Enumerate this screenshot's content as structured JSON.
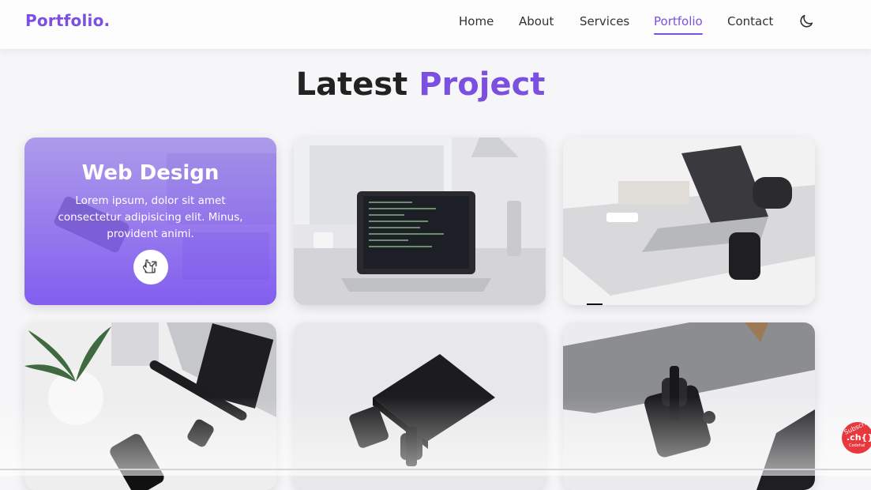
{
  "header": {
    "logo": "Portfolio.",
    "nav": [
      {
        "label": "Home"
      },
      {
        "label": "About"
      },
      {
        "label": "Services"
      },
      {
        "label": "Portfolio",
        "active": true
      },
      {
        "label": "Contact"
      }
    ],
    "theme_icon": "moon-icon"
  },
  "section": {
    "title_dark": "Latest",
    "title_accent": "Project"
  },
  "portfolio": {
    "hover_card": {
      "title": "Web Design",
      "description": "Lorem ipsum, dolor sit amet consectetur adipisicing elit. Minus, provident animi.",
      "link_icon": "external-link-icon"
    },
    "images": [
      "workspace-phone-photo",
      "laptop-code-desk-photo",
      "laptop-desk-photo",
      "laptop-watch-plant-photo",
      "black-laptop-watch-photo",
      "laptop-phone-watch-photo"
    ]
  },
  "overlay_badge": {
    "top": "Subscrib",
    "middle": ".ch{}",
    "bottom": "Codehal"
  },
  "colors": {
    "accent": "#7b4fe0",
    "text": "#333333"
  }
}
